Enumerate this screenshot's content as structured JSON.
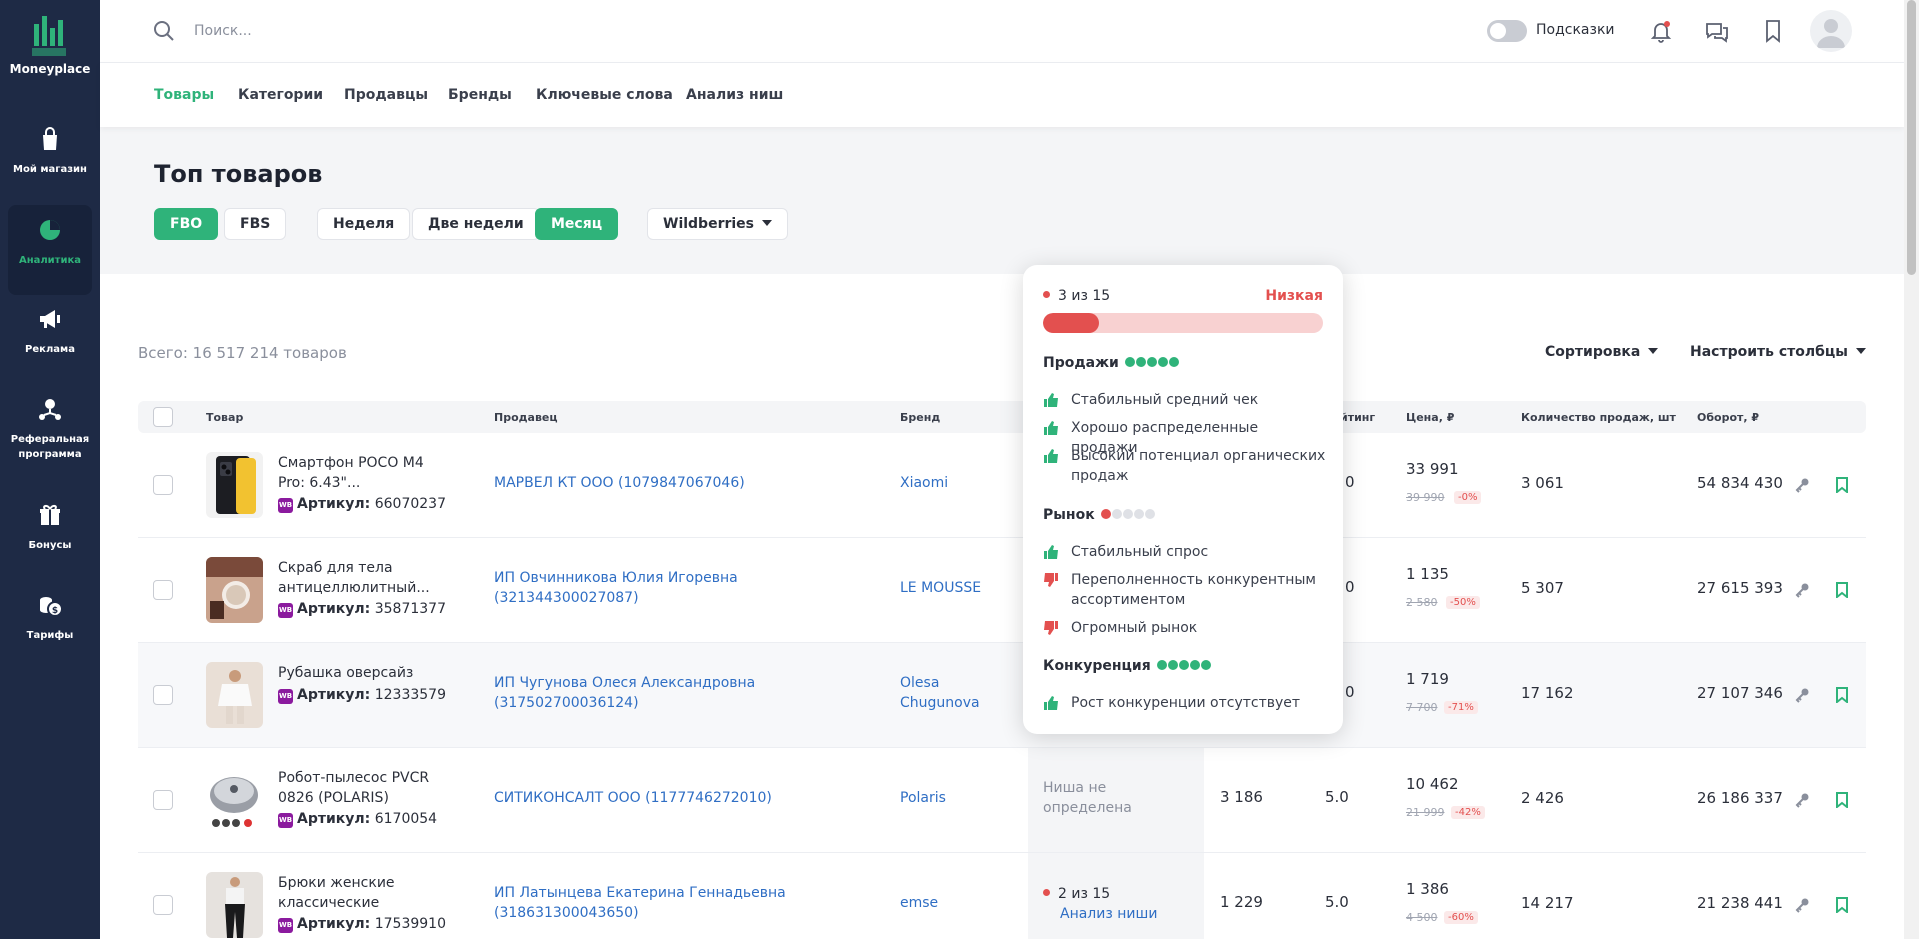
{
  "app": {
    "name": "Moneyplace"
  },
  "sidebar": {
    "items": [
      {
        "label": "Мой магазин",
        "icon": "shopping-bag-icon"
      },
      {
        "label": "Аналитика",
        "icon": "pie-chart-icon",
        "active": true
      },
      {
        "label": "Реклама",
        "icon": "megaphone-icon"
      },
      {
        "label": "Реферальная программа",
        "icon": "referral-icon"
      },
      {
        "label": "Бонусы",
        "icon": "gift-icon"
      },
      {
        "label": "Тарифы",
        "icon": "coins-icon"
      }
    ]
  },
  "header": {
    "search_placeholder": "Поиск...",
    "hints_label": "Подсказки"
  },
  "nav": {
    "tabs": [
      "Товары",
      "Категории",
      "Продавцы",
      "Бренды",
      "Ключевые слова",
      "Анализ ниш"
    ],
    "active_tab": "Товары"
  },
  "page": {
    "title": "Топ товаров",
    "filters": {
      "fbo": "FBO",
      "fbs": "FBS",
      "week": "Неделя",
      "two_weeks": "Две недели",
      "month": "Месяц",
      "marketplace": "Wildberries"
    },
    "total": "Всего: 16 517 214 товаров",
    "sort_label": "Сортировка",
    "columns_label": "Настроить столбцы"
  },
  "table": {
    "headers": {
      "product": "Товар",
      "seller": "Продавец",
      "brand": "Бренд",
      "rating": "йтинг",
      "price": "Цена, ₽",
      "sales": "Количество продаж, шт",
      "revenue": "Оборот, ₽"
    },
    "article_label": "Артикул:",
    "wb_badge": "WB",
    "rows": [
      {
        "name": "Смартфон POCO M4 Pro: 6.43\"...",
        "article": "66070237",
        "seller": "МАРВЕЛ КТ ООО (1079847067046)",
        "brand": "Xiaomi",
        "rating_fragment": "0",
        "price": "33 991",
        "old_price": "39 990",
        "discount": "-0%",
        "sales": "3 061",
        "revenue": "54 834 430"
      },
      {
        "name": "Скраб для тела антицеллюлитный...",
        "article": "35871377",
        "seller": "ИП Овчинникова Юлия Игоревна (321344300027087)",
        "brand": "LE MOUSSE",
        "rating_fragment": "0",
        "price": "1 135",
        "old_price": "2 580",
        "discount": "-50%",
        "sales": "5 307",
        "revenue": "27 615 393"
      },
      {
        "name": "Рубашка оверсайз",
        "article": "12333579",
        "seller": "ИП Чугунова Олеся Александровна (317502700036124)",
        "brand": "Olesa Chugunova",
        "rating_fragment": "0",
        "price": "1 719",
        "old_price": "7 700",
        "discount": "-71%",
        "sales": "17 162",
        "revenue": "27 107 346"
      },
      {
        "name": "Робот-пылесос PVCR 0826 (POLARIS)",
        "article": "6170054",
        "seller": "СИТИКОНСАЛТ ООО (1177746272010)",
        "brand": "Polaris",
        "niche": "Ниша не определена",
        "reviews": "3 186",
        "rating": "5.0",
        "price": "10 462",
        "old_price": "21 999",
        "discount": "-42%",
        "sales": "2 426",
        "revenue": "26 186 337"
      },
      {
        "name": "Брюки женские классические нарядные...",
        "article": "17539910",
        "seller": "ИП Латынцева Екатерина Геннадьевна (318631300043650)",
        "brand": "emse",
        "niche_rank": "2 из 15",
        "niche_link": "Анализ ниши",
        "reviews": "1 229",
        "rating": "5.0",
        "price": "1 386",
        "old_price": "4 500",
        "discount": "-60%",
        "sales": "14 217",
        "revenue": "21 238 441"
      }
    ]
  },
  "popover": {
    "rank": "3 из 15",
    "level": "Низкая",
    "progress_fraction": 0.2,
    "sales_title": "Продажи",
    "sales_items": [
      "Стабильный средний чек",
      "Хорошо распределенные продажи",
      "Высокий потенциал органических продаж"
    ],
    "market_title": "Рынок",
    "market_items": [
      {
        "text": "Стабильный спрос",
        "positive": true
      },
      {
        "text": "Переполненность конкурентным ассортиментом",
        "positive": false
      },
      {
        "text": "Огромный рынок",
        "positive": false
      }
    ],
    "competition_title": "Конкуренция",
    "competition_items": [
      "Рост конкуренции отсутствует"
    ]
  },
  "colors": {
    "accent": "#2fb37a",
    "sidebar": "#1e2a45",
    "danger": "#e3504f",
    "link": "#2f6ec4"
  }
}
